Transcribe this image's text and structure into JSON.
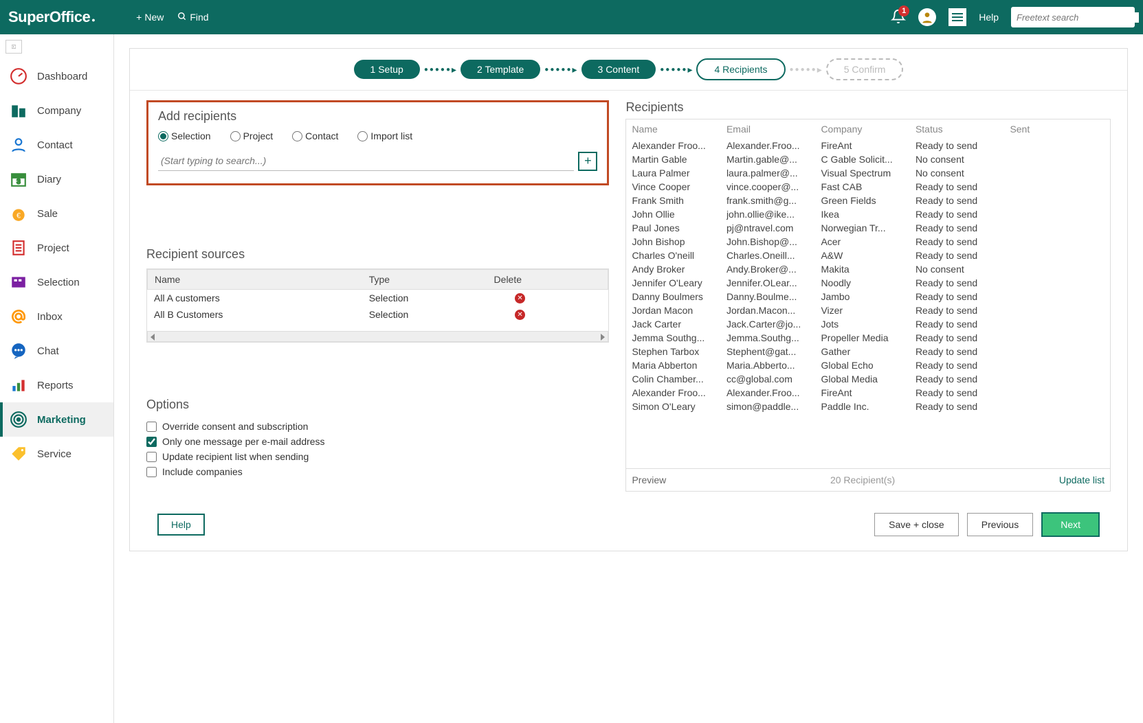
{
  "header": {
    "logo": "SuperOffice",
    "new": "New",
    "find": "Find",
    "help": "Help",
    "search_placeholder": "Freetext search",
    "badge": "1"
  },
  "sidebar": {
    "items": [
      {
        "label": "Dashboard"
      },
      {
        "label": "Company"
      },
      {
        "label": "Contact"
      },
      {
        "label": "Diary"
      },
      {
        "label": "Sale"
      },
      {
        "label": "Project"
      },
      {
        "label": "Selection"
      },
      {
        "label": "Inbox"
      },
      {
        "label": "Chat"
      },
      {
        "label": "Reports"
      },
      {
        "label": "Marketing"
      },
      {
        "label": "Service"
      }
    ]
  },
  "wizard": {
    "steps": [
      "1 Setup",
      "2 Template",
      "3 Content",
      "4 Recipients",
      "5 Confirm"
    ]
  },
  "add": {
    "title": "Add recipients",
    "radios": [
      "Selection",
      "Project",
      "Contact",
      "Import list"
    ],
    "placeholder": "(Start typing to search...)"
  },
  "sources": {
    "title": "Recipient sources",
    "cols": {
      "name": "Name",
      "type": "Type",
      "delete": "Delete"
    },
    "rows": [
      {
        "name": "All A customers",
        "type": "Selection"
      },
      {
        "name": "All B Customers",
        "type": "Selection"
      }
    ]
  },
  "options": {
    "title": "Options",
    "items": [
      {
        "label": "Override consent and subscription",
        "checked": false
      },
      {
        "label": "Only one message per e-mail address",
        "checked": true
      },
      {
        "label": "Update recipient list when sending",
        "checked": false
      },
      {
        "label": "Include companies",
        "checked": false
      }
    ]
  },
  "recipients": {
    "title": "Recipients",
    "cols": {
      "name": "Name",
      "email": "Email",
      "company": "Company",
      "status": "Status",
      "sent": "Sent"
    },
    "rows": [
      {
        "name": "Alexander Froo...",
        "email": "Alexander.Froo...",
        "company": "FireAnt",
        "status": "Ready to send"
      },
      {
        "name": "Martin Gable",
        "email": "Martin.gable@...",
        "company": "C Gable Solicit...",
        "status": "No consent"
      },
      {
        "name": "Laura Palmer",
        "email": "laura.palmer@...",
        "company": "Visual Spectrum",
        "status": "No consent"
      },
      {
        "name": "Vince Cooper",
        "email": "vince.cooper@...",
        "company": "Fast CAB",
        "status": "Ready to send"
      },
      {
        "name": "Frank Smith",
        "email": "frank.smith@g...",
        "company": "Green Fields",
        "status": "Ready to send"
      },
      {
        "name": "John Ollie",
        "email": "john.ollie@ike...",
        "company": "Ikea",
        "status": "Ready to send"
      },
      {
        "name": "Paul Jones",
        "email": "pj@ntravel.com",
        "company": "Norwegian Tr...",
        "status": "Ready to send"
      },
      {
        "name": "John Bishop",
        "email": "John.Bishop@...",
        "company": "Acer",
        "status": "Ready to send"
      },
      {
        "name": "Charles O'neill",
        "email": "Charles.Oneill...",
        "company": "A&W",
        "status": "Ready to send"
      },
      {
        "name": "Andy Broker",
        "email": "Andy.Broker@...",
        "company": "Makita",
        "status": "No consent"
      },
      {
        "name": "Jennifer O'Leary",
        "email": "Jennifer.OLear...",
        "company": "Noodly",
        "status": "Ready to send"
      },
      {
        "name": "Danny Boulmers",
        "email": "Danny.Boulme...",
        "company": "Jambo",
        "status": "Ready to send"
      },
      {
        "name": "Jordan Macon",
        "email": "Jordan.Macon...",
        "company": "Vizer",
        "status": "Ready to send"
      },
      {
        "name": "Jack Carter",
        "email": "Jack.Carter@jo...",
        "company": "Jots",
        "status": "Ready to send"
      },
      {
        "name": "Jemma Southg...",
        "email": "Jemma.Southg...",
        "company": "Propeller Media",
        "status": "Ready to send"
      },
      {
        "name": "Stephen Tarbox",
        "email": "Stephent@gat...",
        "company": "Gather",
        "status": "Ready to send"
      },
      {
        "name": "Maria Abberton",
        "email": "Maria.Abberto...",
        "company": "Global Echo",
        "status": "Ready to send"
      },
      {
        "name": "Colin Chamber...",
        "email": "cc@global.com",
        "company": "Global Media",
        "status": "Ready to send"
      },
      {
        "name": "Alexander Froo...",
        "email": "Alexander.Froo...",
        "company": "FireAnt",
        "status": "Ready to send"
      },
      {
        "name": "Simon O'Leary",
        "email": "simon@paddle...",
        "company": "Paddle Inc.",
        "status": "Ready to send"
      }
    ],
    "preview": "Preview",
    "count": "20 Recipient(s)",
    "update": "Update list"
  },
  "footer": {
    "help": "Help",
    "save": "Save + close",
    "prev": "Previous",
    "next": "Next"
  }
}
